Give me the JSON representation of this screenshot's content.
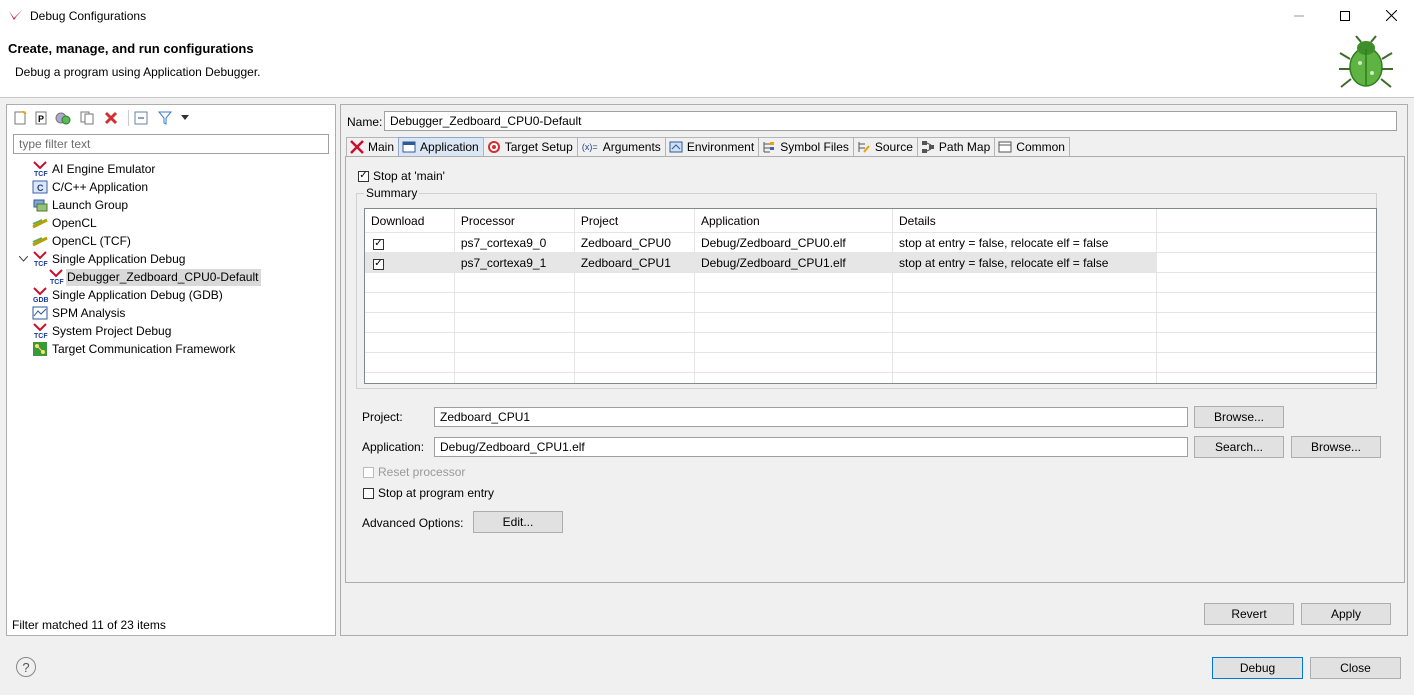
{
  "window": {
    "title": "Debug Configurations"
  },
  "header": {
    "title": "Create, manage, and run configurations",
    "description": "Debug a program using Application Debugger."
  },
  "left": {
    "filter_placeholder": "type filter text",
    "tree": [
      {
        "label": "AI Engine Emulator",
        "icon": "tcf-icon"
      },
      {
        "label": "C/C++ Application",
        "icon": "c-app-icon"
      },
      {
        "label": "Launch Group",
        "icon": "launch-group-icon"
      },
      {
        "label": "OpenCL",
        "icon": "opencl-icon"
      },
      {
        "label": "OpenCL (TCF)",
        "icon": "opencl-icon"
      },
      {
        "label": "Single Application Debug",
        "icon": "tcf-icon"
      },
      {
        "label": "Debugger_Zedboard_CPU0-Default",
        "icon": "tcf-icon"
      },
      {
        "label": "Single Application Debug (GDB)",
        "icon": "gdb-icon"
      },
      {
        "label": "SPM Analysis",
        "icon": "spm-icon"
      },
      {
        "label": "System Project Debug",
        "icon": "tcf-icon"
      },
      {
        "label": "Target Communication Framework",
        "icon": "tcf-framework-icon"
      }
    ],
    "status": "Filter matched 11 of 23 items"
  },
  "right": {
    "name_label": "Name:",
    "name_value": "Debugger_Zedboard_CPU0-Default",
    "tabs": [
      "Main",
      "Application",
      "Target Setup",
      "Arguments",
      "Environment",
      "Symbol Files",
      "Source",
      "Path Map",
      "Common"
    ],
    "stop_at_main": "Stop at 'main'",
    "summary_label": "Summary",
    "table": {
      "headers": [
        "Download",
        "Processor",
        "Project",
        "Application",
        "Details"
      ],
      "rows": [
        [
          "ps7_cortexa9_0",
          "Zedboard_CPU0",
          "Debug/Zedboard_CPU0.elf",
          "stop at entry = false, relocate elf = false"
        ],
        [
          "ps7_cortexa9_1",
          "Zedboard_CPU1",
          "Debug/Zedboard_CPU1.elf",
          "stop at entry = false, relocate elf = false"
        ]
      ]
    },
    "project_label": "Project:",
    "project_value": "Zedboard_CPU1",
    "application_label": "Application:",
    "application_value": "Debug/Zedboard_CPU1.elf",
    "browse": "Browse...",
    "search": "Search...",
    "reset_processor": "Reset processor",
    "stop_at_entry": "Stop at program entry",
    "advanced_label": "Advanced Options:",
    "edit": "Edit...",
    "revert": "Revert",
    "apply": "Apply"
  },
  "footer": {
    "debug": "Debug",
    "close": "Close"
  },
  "colors": {
    "accent": "#0078d7",
    "xilinx_red": "#c8102e"
  }
}
